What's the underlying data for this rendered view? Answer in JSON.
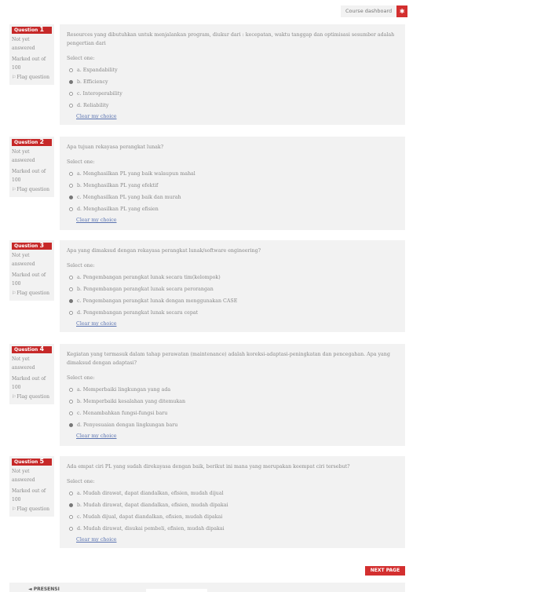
{
  "topbar": {
    "course_dashboard": "Course dashboard",
    "gear_icon": "gear-icon"
  },
  "questions": [
    {
      "label": "Question",
      "number": "1",
      "status": "Not yet answered",
      "marked": "Marked out of 100",
      "flag": "Flag question",
      "text": "Resources yang dibutuhkan untuk menjalankan program, diukur dari : kecepatan, waktu tanggap dan optimisasi sesumber adalah pengertian dari",
      "prompt": "Select one:",
      "options": [
        "a. Expandability",
        "b. Efficiency",
        "c. Interoperability",
        "d. Reliability"
      ],
      "selected": 1,
      "clear": "Clear my choice"
    },
    {
      "label": "Question",
      "number": "2",
      "status": "Not yet answered",
      "marked": "Marked out of 100",
      "flag": "Flag question",
      "text": "Apa tujuan rekayasa perangkat lunak?",
      "prompt": "Select one:",
      "options": [
        "a. Menghasilkan PL yang baik walaupun mahal",
        "b. Menghasilkan PL yang efektif",
        "c. Menghasilkan PL yang baik dan murah",
        "d. Menghasilkan PL yang efisien"
      ],
      "selected": 2,
      "clear": "Clear my choice"
    },
    {
      "label": "Question",
      "number": "3",
      "status": "Not yet answered",
      "marked": "Marked out of 100",
      "flag": "Flag question",
      "text": "Apa yang dimaksud dengan rekayasa perangkat lunak/software engineering?",
      "prompt": "Select one:",
      "options": [
        "a. Pengembangan perangkat lunak secara tim(kelompok)",
        "b. Pengembangan perangkat lunak secara perorangan",
        "c. Pengembangan perangkat lunak dengan menggunakan CASE",
        "d. Pengembangan perangkat lunak secara cepat"
      ],
      "selected": 2,
      "clear": "Clear my choice"
    },
    {
      "label": "Question",
      "number": "4",
      "status": "Not yet answered",
      "marked": "Marked out of 100",
      "flag": "Flag question",
      "text": "Kegiatan yang termasuk dalam tahap perawatan (maintenance) adalah koreksi-adaptasi-peningkatan dan pencegahan. Apa yang dimaksud dengan adaptasi?",
      "prompt": "Select one:",
      "options": [
        "a. Memperbaiki lingkungan yang ada",
        "b. Memperbaiki kesalahan yang ditemukan",
        "c. Menambahkan fungsi-fungsi baru",
        "d. Penyesuaian dengan lingkungan baru"
      ],
      "selected": 3,
      "clear": "Clear my choice"
    },
    {
      "label": "Question",
      "number": "5",
      "status": "Not yet answered",
      "marked": "Marked out of 100",
      "flag": "Flag question",
      "text": "Ada empat ciri PL yang sudah direkayasa dengan baik, berikut ini mana yang merupakan keempat ciri tersebut?",
      "prompt": "Select one:",
      "options": [
        "a. Mudah dirawat, dapat diandalkan, efisien, mudah dijual",
        "b. Mudah dirawat, dapat diandalkan, efisien, mudah dipakai",
        "c. Mudah dijual, dapat diandalkan, efisien, mudah dipakai",
        "d. Mudah dirawat, disukai pembeli, efisien, mudah dipakai"
      ],
      "selected": 1,
      "clear": "Clear my choice"
    }
  ],
  "next_page": "NEXT PAGE",
  "footer": {
    "previous": "◄ PRESENSI"
  }
}
